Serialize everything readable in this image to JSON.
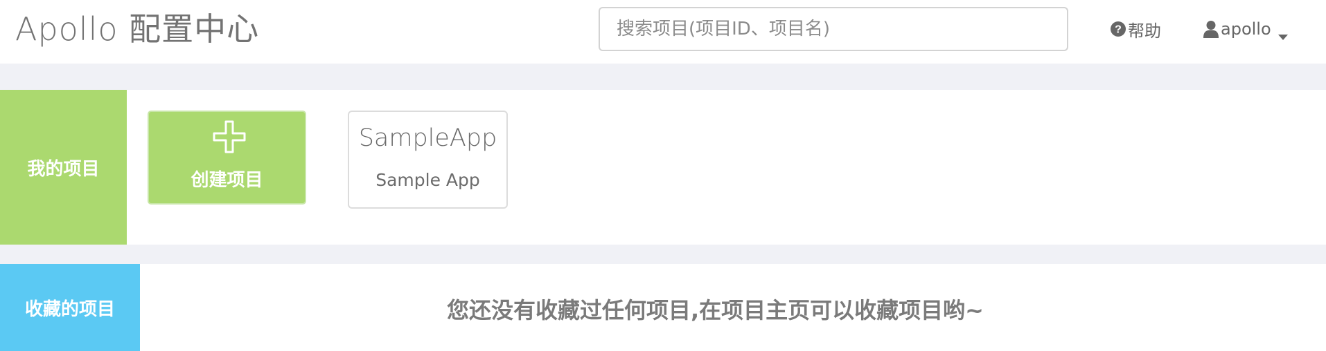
{
  "header": {
    "brand": "Apollo 配置中心",
    "search": {
      "placeholder": "搜索项目(项目ID、项目名)",
      "value": ""
    },
    "help": {
      "icon": "question-circle-icon",
      "label": "帮助"
    },
    "user": {
      "icon": "user-icon",
      "name": "apollo",
      "dropdown_icon": "caret-down-icon"
    }
  },
  "my_projects": {
    "label": "我的项目",
    "color": "#abd96f",
    "create": {
      "icon": "plus-icon",
      "label": "创建项目"
    },
    "apps": [
      {
        "app_id": "SampleApp",
        "name": "Sample App"
      }
    ]
  },
  "favorites": {
    "label": "收藏的项目",
    "color": "#5bc9f3",
    "empty_message": "您还没有收藏过任何项目,在项目主页可以收藏项目哟~"
  }
}
